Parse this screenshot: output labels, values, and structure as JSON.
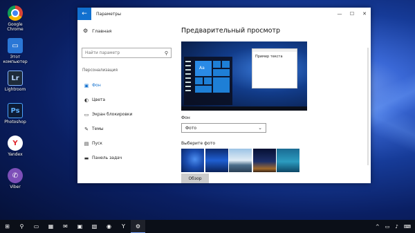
{
  "desktop": {
    "icons": [
      {
        "label": "Google Chrome",
        "icon": "chrome-icon"
      },
      {
        "label": "Этот компьютер",
        "icon": "computer-icon"
      },
      {
        "label": "Lightroom",
        "icon": "lightroom-icon",
        "glyph": "Lr"
      },
      {
        "label": "Photoshop",
        "icon": "photoshop-icon",
        "glyph": "Ps"
      },
      {
        "label": "Yandex",
        "icon": "yandex-icon",
        "glyph": "Y"
      },
      {
        "label": "Viber",
        "icon": "viber-icon",
        "glyph": "✆"
      }
    ]
  },
  "window": {
    "title": "Параметры",
    "back_icon": "←",
    "controls": {
      "minimize": "—",
      "maximize": "☐",
      "close": "✕"
    }
  },
  "sidebar": {
    "home": "Главная",
    "search_placeholder": "Найти параметр",
    "section": "Персонализация",
    "items": [
      {
        "label": "Фон",
        "icon": "image-icon",
        "glyph": "▣",
        "active": true
      },
      {
        "label": "Цвета",
        "icon": "palette-icon",
        "glyph": "◐"
      },
      {
        "label": "Экран блокировки",
        "icon": "lockscreen-icon",
        "glyph": "▭"
      },
      {
        "label": "Темы",
        "icon": "brush-icon",
        "glyph": "✎"
      },
      {
        "label": "Пуск",
        "icon": "start-icon",
        "glyph": "▤"
      },
      {
        "label": "Панель задач",
        "icon": "taskbar-icon",
        "glyph": "▬"
      }
    ]
  },
  "main": {
    "heading": "Предварительный просмотр",
    "preview_sample_text": "Пример текста",
    "preview_tile_text": "Aa",
    "background_label": "Фон",
    "background_value": "Фото",
    "choose_photo_label": "Выберите фото",
    "browse_button": "Обзор"
  },
  "taskbar": {
    "items": [
      {
        "icon": "windows-start-icon",
        "glyph": "⊞"
      },
      {
        "icon": "search-icon",
        "glyph": "⚲"
      },
      {
        "icon": "task-view-icon",
        "glyph": "▭"
      },
      {
        "icon": "explorer-icon",
        "glyph": "▦"
      },
      {
        "icon": "mail-icon",
        "glyph": "✉"
      },
      {
        "icon": "store-icon",
        "glyph": "▣"
      },
      {
        "icon": "photos-icon",
        "glyph": "▧"
      },
      {
        "icon": "chrome-icon",
        "glyph": "◉"
      },
      {
        "icon": "yandex-icon",
        "glyph": "Y"
      },
      {
        "icon": "settings-icon",
        "glyph": "⚙",
        "open": true
      }
    ],
    "tray": [
      "^",
      "▭",
      "♪",
      "⌨"
    ]
  },
  "colors": {
    "accent": "#1170cf",
    "taskbar": "#0b0f18"
  }
}
